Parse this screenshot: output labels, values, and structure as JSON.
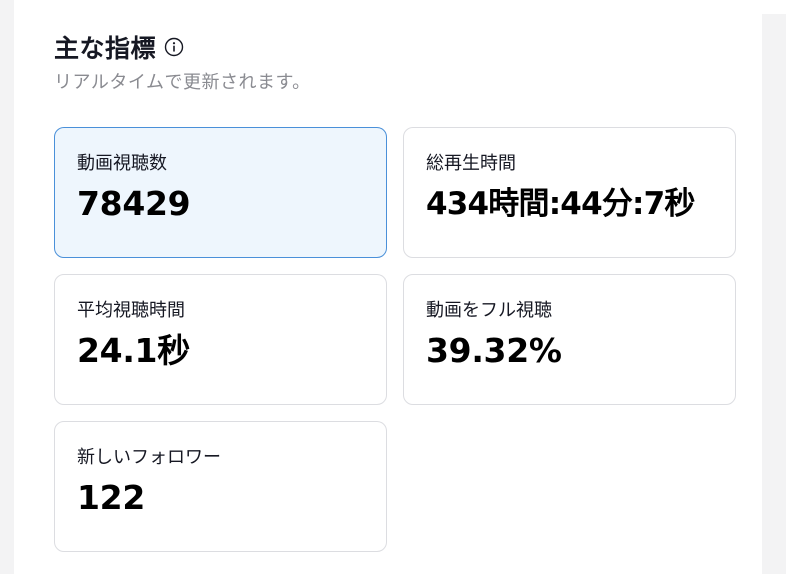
{
  "header": {
    "title": "主な指標",
    "subtitle": "リアルタイムで更新されます。"
  },
  "icons": {
    "info": "info-icon"
  },
  "colors": {
    "selected_border": "#4a90d9",
    "selected_background": "#eef6fd",
    "card_border": "#dcdde1",
    "text_primary": "#161823",
    "text_secondary": "#8a8b91"
  },
  "metrics": [
    {
      "label": "動画視聴数",
      "value": "78429",
      "selected": true
    },
    {
      "label": "総再生時間",
      "value": "434時間:44分:7秒",
      "selected": false
    },
    {
      "label": "平均視聴時間",
      "value": "24.1秒",
      "selected": false
    },
    {
      "label": "動画をフル視聴",
      "value": "39.32%",
      "selected": false
    },
    {
      "label": "新しいフォロワー",
      "value": "122",
      "selected": false
    }
  ]
}
